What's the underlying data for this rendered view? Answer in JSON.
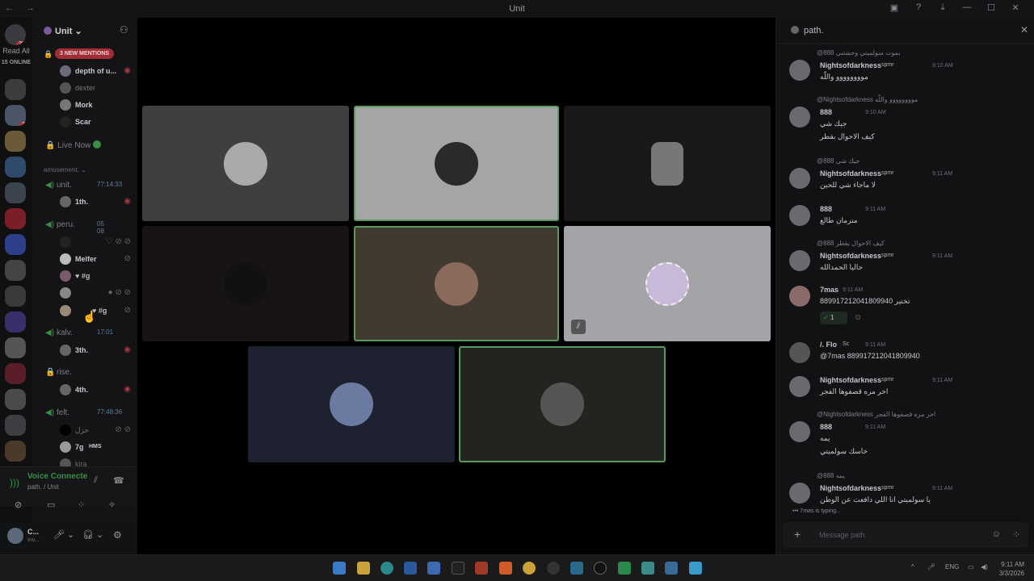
{
  "window": {
    "title": "Unit",
    "nav": "← →"
  },
  "servers": {
    "read_all": "Read All",
    "online": "15 ONLINE",
    "dm_badge": "21",
    "badge2": "3"
  },
  "channels": {
    "guild_name": "Unit",
    "mentions_pill": "3 NEW MENTIONS",
    "live_now": "Live Now",
    "category": "amusement.",
    "top_members": [
      "depth of u...",
      "dexter",
      "Mork",
      "Scar"
    ],
    "voice": [
      {
        "name": "unit.",
        "time": "77:14:33",
        "members": [
          "1th."
        ]
      },
      {
        "name": "peru.",
        "time": "05  08",
        "members": [
          "",
          "Melfer",
          "",
          "",
          ""
        ]
      },
      {
        "name": "kalv.",
        "time": "17:01",
        "members": [
          "3th."
        ]
      },
      {
        "name": "rise.",
        "time": "",
        "members": [
          "4th."
        ]
      },
      {
        "name": "felt.",
        "time": "77:48:36",
        "members": [
          "حزل",
          "7g",
          "kira"
        ]
      }
    ],
    "hms_label": "HMS",
    "voice_connected": "Voice Connecte",
    "voice_sub": "path. / Unit",
    "user_name": "C...",
    "user_status": "Inv..."
  },
  "chat": {
    "channel": "path.",
    "composer_placeholder": "Message path.",
    "typing": "7mas is typing...",
    "messages": [
      {
        "reply": "@888 بموت سولميتي وحشتني",
        "author": "Nightsofdarkness",
        "tag": "spmr",
        "time": "9:10 AM",
        "lines": [
          "موووووووو واللّه"
        ]
      },
      {
        "reply": "@Nightsofdarkness موووووووو واللّه",
        "author": "888",
        "tag": "",
        "time": "9:10 AM",
        "lines": [
          "جيك شي",
          "كيف الاحوال بقطر"
        ]
      },
      {
        "reply": "@888 جيك شي",
        "author": "Nightsofdarkness",
        "tag": "spmr",
        "time": "9:11 AM",
        "lines": [
          "لا ماجاء شي للحين"
        ]
      },
      {
        "reply": "",
        "author": "888",
        "tag": "",
        "time": "9:11 AM",
        "lines": [
          "مترمان طالع"
        ]
      },
      {
        "reply": "@888 كيف الاحوال بقطر",
        "author": "Nightsofdarkness",
        "tag": "spmr",
        "time": "9:11 AM",
        "lines": [
          "حاليا الحمدالله"
        ]
      },
      {
        "reply": "",
        "author": "7mas",
        "tag": "",
        "time": "9:11 AM",
        "lines": [
          "889917212041809940 تختير"
        ],
        "reaction": "1"
      },
      {
        "reply": "",
        "author": "/. Flo",
        "tag": "Sc",
        "time": "9:11 AM",
        "lines": [
          "@7mas 889917212041809940"
        ]
      },
      {
        "reply": "",
        "author": "Nightsofdarkness",
        "tag": "spmr",
        "time": "9:11 AM",
        "lines": [
          "اخر مره قصفوها الفجر"
        ]
      },
      {
        "reply": "@Nightsofdarkness اخر مره قصفوها الفجر",
        "author": "888",
        "tag": "",
        "time": "9:11 AM",
        "lines": [
          "يمه",
          "خاسك سولميتي"
        ]
      },
      {
        "reply": "@888 يمه",
        "author": "Nightsofdarkness",
        "tag": "spmr",
        "time": "9:11 AM",
        "lines": [
          "يا سولميتي انا اللي دافعت عن الوطن"
        ]
      }
    ]
  },
  "taskbar": {
    "lang": "ENG",
    "time": "9:11 AM",
    "date": "3/3/2026"
  },
  "colors": {
    "speaking": "#5a9a5f",
    "accent_red": "#a32d35",
    "online_green": "#3a8f48"
  }
}
